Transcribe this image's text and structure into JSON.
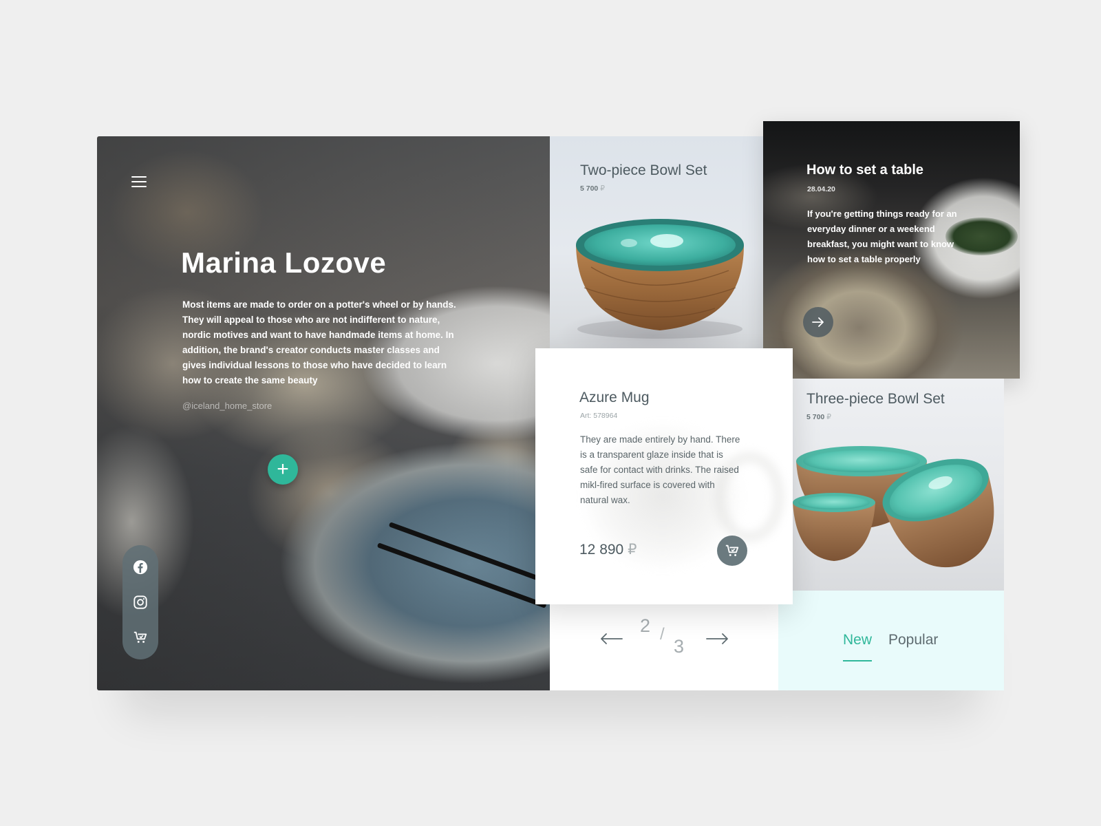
{
  "hero": {
    "title": "Marina Lozove",
    "description": "Most items are made to order on a potter's wheel or by hands. They will appeal to those who are not indifferent to nature, nordic motives and want to have handmade items at home. In addition, the brand's creator conducts master classes and gives individual lessons to those who have decided to learn how to create the same beauty",
    "handle": "@iceland_home_store",
    "plus_label": "+"
  },
  "social": {
    "icons": [
      "facebook-icon",
      "instagram-icon",
      "cart-icon"
    ]
  },
  "products": [
    {
      "title": "Two-piece Bowl Set",
      "price": "5 700",
      "currency": "₽"
    },
    {
      "title": "Three-piece Bowl Set",
      "price": "5 700",
      "currency": "₽"
    }
  ],
  "blog": {
    "title": "How to set a table",
    "date": "28.04.20",
    "text": "If you're getting things ready for an everyday dinner or a weekend breakfast, you might want to know how to set a table properly"
  },
  "featured": {
    "title": "Azure Mug",
    "article": "Art: 578964",
    "description": "They are made entirely by hand. There is a transparent glaze inside that is safe for contact with drinks. The raised mikl-fired surface is covered with natural wax.",
    "price": "12 890",
    "currency": "₽"
  },
  "pagination": {
    "current": "2",
    "separator": "/",
    "total": "3"
  },
  "tabs": {
    "items": [
      "New",
      "Popular"
    ],
    "active": "New"
  },
  "colors": {
    "accent": "#2fb79a",
    "text_dark": "#4d5a60",
    "tabs_bg": "#e9fbfb",
    "page_bg": "#efefef"
  }
}
